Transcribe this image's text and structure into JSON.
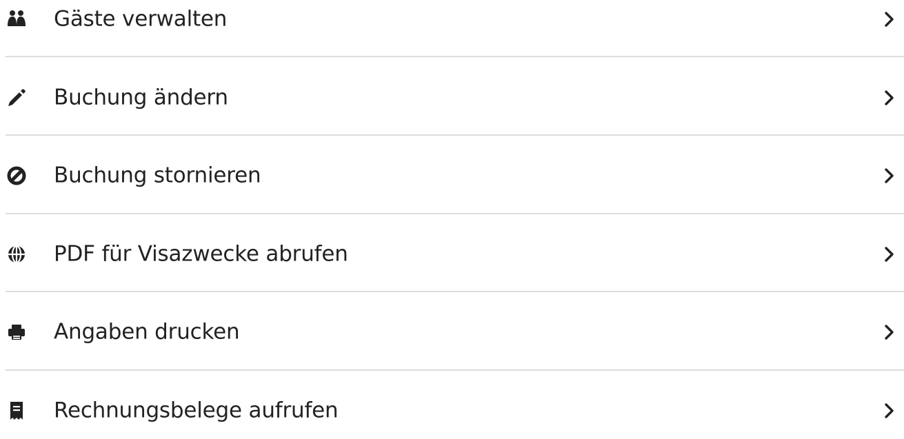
{
  "menu": {
    "items": [
      {
        "label": "Gäste verwalten",
        "icon": "users-icon"
      },
      {
        "label": "Buchung ändern",
        "icon": "pencil-icon"
      },
      {
        "label": "Buchung stornieren",
        "icon": "ban-icon"
      },
      {
        "label": "PDF für Visazwecke abrufen",
        "icon": "globe-icon"
      },
      {
        "label": "Angaben drucken",
        "icon": "printer-icon"
      },
      {
        "label": "Rechnungsbelege aufrufen",
        "icon": "receipt-icon"
      }
    ],
    "chevron_icon": "chevron-right-icon"
  },
  "colors": {
    "text": "#222222",
    "divider": "#dddddd",
    "background": "#ffffff"
  }
}
